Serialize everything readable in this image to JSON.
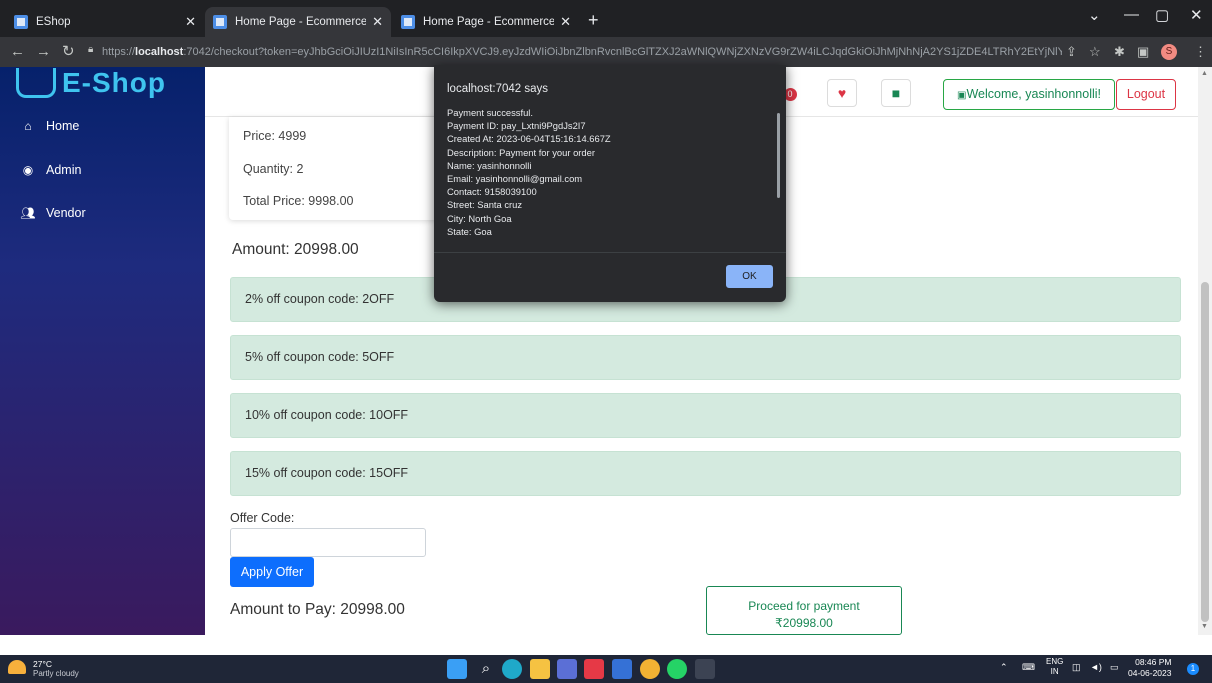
{
  "browser": {
    "tabs": [
      {
        "label": "EShop"
      },
      {
        "label": "Home Page - Ecommerce"
      },
      {
        "label": "Home Page - Ecommerce"
      }
    ],
    "url_prefix": "https://",
    "url_host": "localhost",
    "url_rest": ":7042/checkout?token=eyJhbGciOiJIUzI1NiIsInR5cCI6IkpXVCJ9.eyJzdWIiOiJbnZlbnRvcnlBcGlTZXJ2aWNlQWNjZXNzVG9rZW4iLCJqdGkiOiJhMjNhNjA2YS1jZDE4LTRhY2EtYjNlYi...",
    "profile_initial": "S"
  },
  "sidebar": {
    "logo_text": "E-Shop",
    "items": [
      {
        "label": "Home",
        "icon": "home-icon"
      },
      {
        "label": "Admin",
        "icon": "user-circle-icon"
      },
      {
        "label": "Vendor",
        "icon": "users-icon"
      }
    ]
  },
  "header": {
    "cart_badge": "0",
    "welcome_label": "Welcome, yasinhonnolli!",
    "logout_label": "Logout"
  },
  "order": {
    "price": "Price: 4999",
    "quantity": "Quantity: 2",
    "total": "Total Price: 9998.00",
    "amount": "Amount: 20998.00"
  },
  "coupons": [
    "2% off coupon code: 2OFF",
    "5% off coupon code: 5OFF",
    "10% off coupon code: 10OFF",
    "15% off coupon code: 15OFF"
  ],
  "offer": {
    "label": "Offer Code:",
    "value": "",
    "apply_label": "Apply Offer"
  },
  "payment": {
    "amount_to_pay": "Amount to Pay: 20998.00",
    "proceed_line1": "Proceed for payment",
    "proceed_line2": "₹20998.00"
  },
  "dialog": {
    "title": "localhost:7042 says",
    "lines": [
      "Payment successful.",
      "Payment ID: pay_Lxtni9PgdJs2I7",
      "Created At: 2023-06-04T15:16:14.667Z",
      "Description: Payment for your order",
      "Name: yasinhonnolli",
      "Email: yasinhonnolli@gmail.com",
      "Contact: 9158039100",
      "Street: Santa cruz",
      "City: North Goa",
      "State: Goa"
    ],
    "ok_label": "OK"
  },
  "taskbar": {
    "temp": "27°C",
    "weather": "Partly cloudy",
    "lang1": "ENG",
    "lang2": "IN",
    "time": "08:46 PM",
    "date": "04-06-2023",
    "notification_count": "1"
  },
  "colors": {
    "coupon_bg": "#d4eadf",
    "primary": "#0d6efd",
    "success": "#198754",
    "danger": "#dc3545",
    "dialog_bg": "#292a2d"
  }
}
